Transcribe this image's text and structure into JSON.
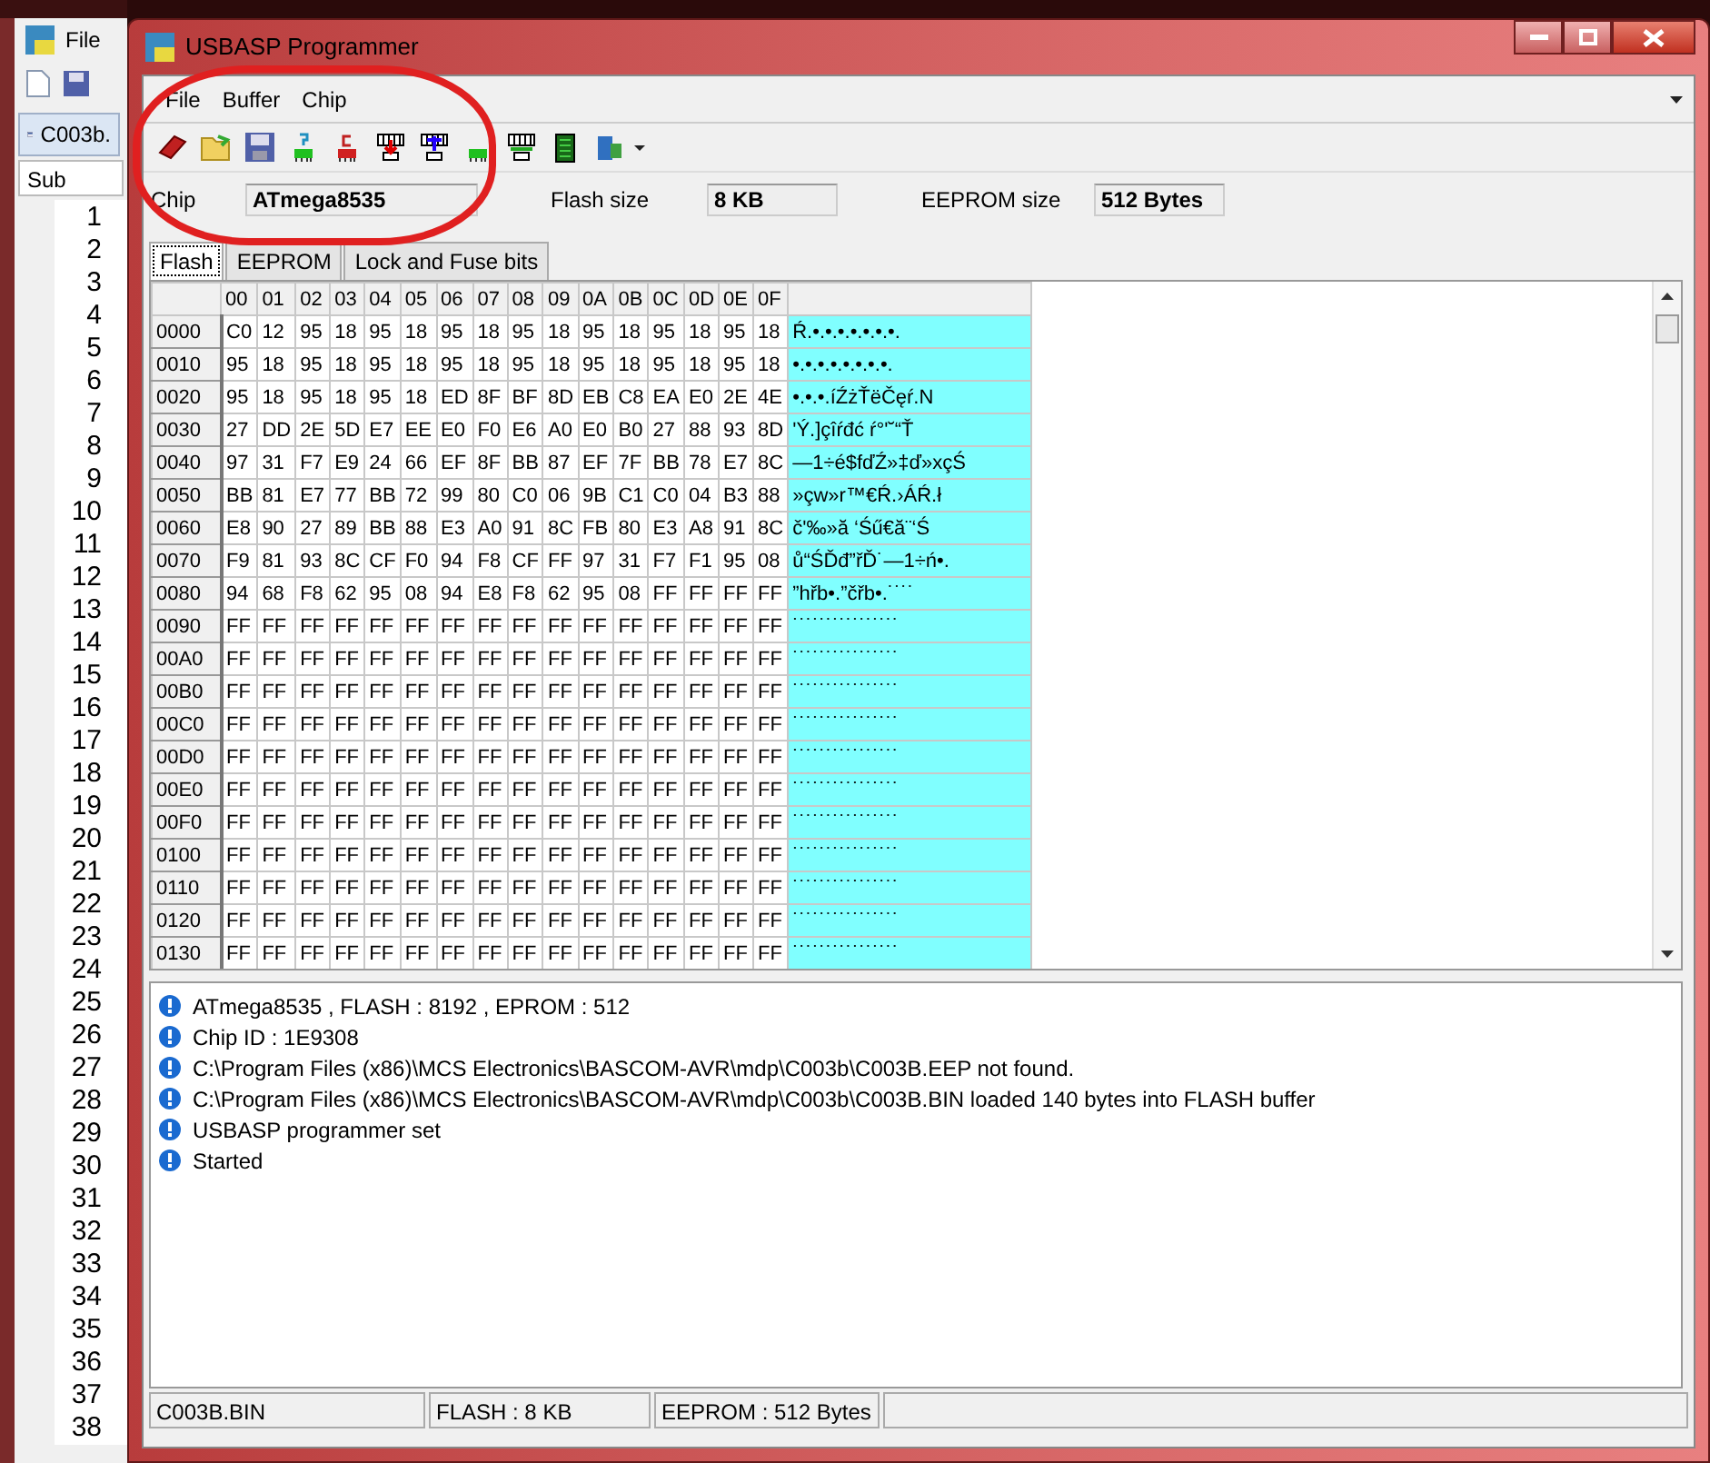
{
  "background_app": {
    "menu": [
      "File"
    ],
    "tab": "C003b.",
    "label": "Sub",
    "line_numbers": [
      "1",
      "2",
      "3",
      "4",
      "5",
      "6",
      "7",
      "8",
      "9",
      "10",
      "11",
      "12",
      "13",
      "14",
      "15",
      "16",
      "17",
      "18",
      "19",
      "20",
      "21",
      "22",
      "23",
      "24",
      "25",
      "26",
      "27",
      "28",
      "29",
      "30",
      "31",
      "32",
      "33",
      "34",
      "35",
      "36",
      "37",
      "38"
    ]
  },
  "window": {
    "title": "USBASP Programmer"
  },
  "menu": [
    "File",
    "Buffer",
    "Chip"
  ],
  "chip_info": [
    {
      "label": "Chip",
      "value": "ATmega8535"
    },
    {
      "label": "Flash size",
      "value": "8 KB"
    },
    {
      "label": "EEPROM size",
      "value": "512 Bytes"
    }
  ],
  "tabs": [
    {
      "label": "Flash",
      "selected": true
    },
    {
      "label": "EEPROM",
      "selected": false
    },
    {
      "label": "Lock and Fuse bits",
      "selected": false
    }
  ],
  "hex_grid": {
    "columns": [
      "00",
      "01",
      "02",
      "03",
      "04",
      "05",
      "06",
      "07",
      "08",
      "09",
      "0A",
      "0B",
      "0C",
      "0D",
      "0E",
      "0F"
    ],
    "rows": [
      {
        "address": "0000",
        "bytes": [
          "C0",
          "12",
          "95",
          "18",
          "95",
          "18",
          "95",
          "18",
          "95",
          "18",
          "95",
          "18",
          "95",
          "18",
          "95",
          "18"
        ],
        "ascii": "Ŕ.•.•.•.•.•.•.•."
      },
      {
        "address": "0010",
        "bytes": [
          "95",
          "18",
          "95",
          "18",
          "95",
          "18",
          "95",
          "18",
          "95",
          "18",
          "95",
          "18",
          "95",
          "18",
          "95",
          "18"
        ],
        "ascii": "•.•.•.•.•.•.•.•."
      },
      {
        "address": "0020",
        "bytes": [
          "95",
          "18",
          "95",
          "18",
          "95",
          "18",
          "ED",
          "8F",
          "BF",
          "8D",
          "EB",
          "C8",
          "EA",
          "E0",
          "2E",
          "4E"
        ],
        "ascii": "•.•.•.íŹżŤëČęŕ.N"
      },
      {
        "address": "0030",
        "bytes": [
          "27",
          "DD",
          "2E",
          "5D",
          "E7",
          "EE",
          "E0",
          "F0",
          "E6",
          "A0",
          "E0",
          "B0",
          "27",
          "88",
          "93",
          "8D"
        ],
        "ascii": "'Ý.]çîŕđć ŕ°'˘“Ť"
      },
      {
        "address": "0040",
        "bytes": [
          "97",
          "31",
          "F7",
          "E9",
          "24",
          "66",
          "EF",
          "8F",
          "BB",
          "87",
          "EF",
          "7F",
          "BB",
          "78",
          "E7",
          "8C"
        ],
        "ascii": "—1÷é$fďŹ»‡ď»xçŚ"
      },
      {
        "address": "0050",
        "bytes": [
          "BB",
          "81",
          "E7",
          "77",
          "BB",
          "72",
          "99",
          "80",
          "C0",
          "06",
          "9B",
          "C1",
          "C0",
          "04",
          "B3",
          "88"
        ],
        "ascii": "»çw»r™€Ŕ.›ÁŔ.ł"
      },
      {
        "address": "0060",
        "bytes": [
          "E8",
          "90",
          "27",
          "89",
          "BB",
          "88",
          "E3",
          "A0",
          "91",
          "8C",
          "FB",
          "80",
          "E3",
          "A8",
          "91",
          "8C"
        ],
        "ascii": "č'‰»ă ‘Śű€ă¨‘Ś"
      },
      {
        "address": "0070",
        "bytes": [
          "F9",
          "81",
          "93",
          "8C",
          "CF",
          "F0",
          "94",
          "F8",
          "CF",
          "FF",
          "97",
          "31",
          "F7",
          "F1",
          "95",
          "08"
        ],
        "ascii": "ů“ŚĎđ”řĎ˙—1÷ń•."
      },
      {
        "address": "0080",
        "bytes": [
          "94",
          "68",
          "F8",
          "62",
          "95",
          "08",
          "94",
          "E8",
          "F8",
          "62",
          "95",
          "08",
          "FF",
          "FF",
          "FF",
          "FF"
        ],
        "ascii": "”hřb•.”čřb•.˙˙˙˙"
      },
      {
        "address": "0090",
        "bytes": [
          "FF",
          "FF",
          "FF",
          "FF",
          "FF",
          "FF",
          "FF",
          "FF",
          "FF",
          "FF",
          "FF",
          "FF",
          "FF",
          "FF",
          "FF",
          "FF"
        ],
        "ascii": "˙˙˙˙˙˙˙˙˙˙˙˙˙˙˙˙"
      },
      {
        "address": "00A0",
        "bytes": [
          "FF",
          "FF",
          "FF",
          "FF",
          "FF",
          "FF",
          "FF",
          "FF",
          "FF",
          "FF",
          "FF",
          "FF",
          "FF",
          "FF",
          "FF",
          "FF"
        ],
        "ascii": "˙˙˙˙˙˙˙˙˙˙˙˙˙˙˙˙"
      },
      {
        "address": "00B0",
        "bytes": [
          "FF",
          "FF",
          "FF",
          "FF",
          "FF",
          "FF",
          "FF",
          "FF",
          "FF",
          "FF",
          "FF",
          "FF",
          "FF",
          "FF",
          "FF",
          "FF"
        ],
        "ascii": "˙˙˙˙˙˙˙˙˙˙˙˙˙˙˙˙"
      },
      {
        "address": "00C0",
        "bytes": [
          "FF",
          "FF",
          "FF",
          "FF",
          "FF",
          "FF",
          "FF",
          "FF",
          "FF",
          "FF",
          "FF",
          "FF",
          "FF",
          "FF",
          "FF",
          "FF"
        ],
        "ascii": "˙˙˙˙˙˙˙˙˙˙˙˙˙˙˙˙"
      },
      {
        "address": "00D0",
        "bytes": [
          "FF",
          "FF",
          "FF",
          "FF",
          "FF",
          "FF",
          "FF",
          "FF",
          "FF",
          "FF",
          "FF",
          "FF",
          "FF",
          "FF",
          "FF",
          "FF"
        ],
        "ascii": "˙˙˙˙˙˙˙˙˙˙˙˙˙˙˙˙"
      },
      {
        "address": "00E0",
        "bytes": [
          "FF",
          "FF",
          "FF",
          "FF",
          "FF",
          "FF",
          "FF",
          "FF",
          "FF",
          "FF",
          "FF",
          "FF",
          "FF",
          "FF",
          "FF",
          "FF"
        ],
        "ascii": "˙˙˙˙˙˙˙˙˙˙˙˙˙˙˙˙"
      },
      {
        "address": "00F0",
        "bytes": [
          "FF",
          "FF",
          "FF",
          "FF",
          "FF",
          "FF",
          "FF",
          "FF",
          "FF",
          "FF",
          "FF",
          "FF",
          "FF",
          "FF",
          "FF",
          "FF"
        ],
        "ascii": "˙˙˙˙˙˙˙˙˙˙˙˙˙˙˙˙"
      },
      {
        "address": "0100",
        "bytes": [
          "FF",
          "FF",
          "FF",
          "FF",
          "FF",
          "FF",
          "FF",
          "FF",
          "FF",
          "FF",
          "FF",
          "FF",
          "FF",
          "FF",
          "FF",
          "FF"
        ],
        "ascii": "˙˙˙˙˙˙˙˙˙˙˙˙˙˙˙˙"
      },
      {
        "address": "0110",
        "bytes": [
          "FF",
          "FF",
          "FF",
          "FF",
          "FF",
          "FF",
          "FF",
          "FF",
          "FF",
          "FF",
          "FF",
          "FF",
          "FF",
          "FF",
          "FF",
          "FF"
        ],
        "ascii": "˙˙˙˙˙˙˙˙˙˙˙˙˙˙˙˙"
      },
      {
        "address": "0120",
        "bytes": [
          "FF",
          "FF",
          "FF",
          "FF",
          "FF",
          "FF",
          "FF",
          "FF",
          "FF",
          "FF",
          "FF",
          "FF",
          "FF",
          "FF",
          "FF",
          "FF"
        ],
        "ascii": "˙˙˙˙˙˙˙˙˙˙˙˙˙˙˙˙"
      },
      {
        "address": "0130",
        "bytes": [
          "FF",
          "FF",
          "FF",
          "FF",
          "FF",
          "FF",
          "FF",
          "FF",
          "FF",
          "FF",
          "FF",
          "FF",
          "FF",
          "FF",
          "FF",
          "FF"
        ],
        "ascii": "˙˙˙˙˙˙˙˙˙˙˙˙˙˙˙˙"
      }
    ]
  },
  "log": [
    "ATmega8535 , FLASH : 8192 , EPROM : 512",
    "Chip ID : 1E9308",
    "C:\\Program Files (x86)\\MCS Electronics\\BASCOM-AVR\\mdp\\C003b\\C003B.EEP not found.",
    "C:\\Program Files (x86)\\MCS Electronics\\BASCOM-AVR\\mdp\\C003b\\C003B.BIN loaded 140 bytes into FLASH buffer",
    "USBASP programmer set",
    "Started"
  ],
  "status_bar": [
    "C003B.BIN",
    "FLASH : 8 KB",
    "EEPROM : 512 Bytes"
  ]
}
